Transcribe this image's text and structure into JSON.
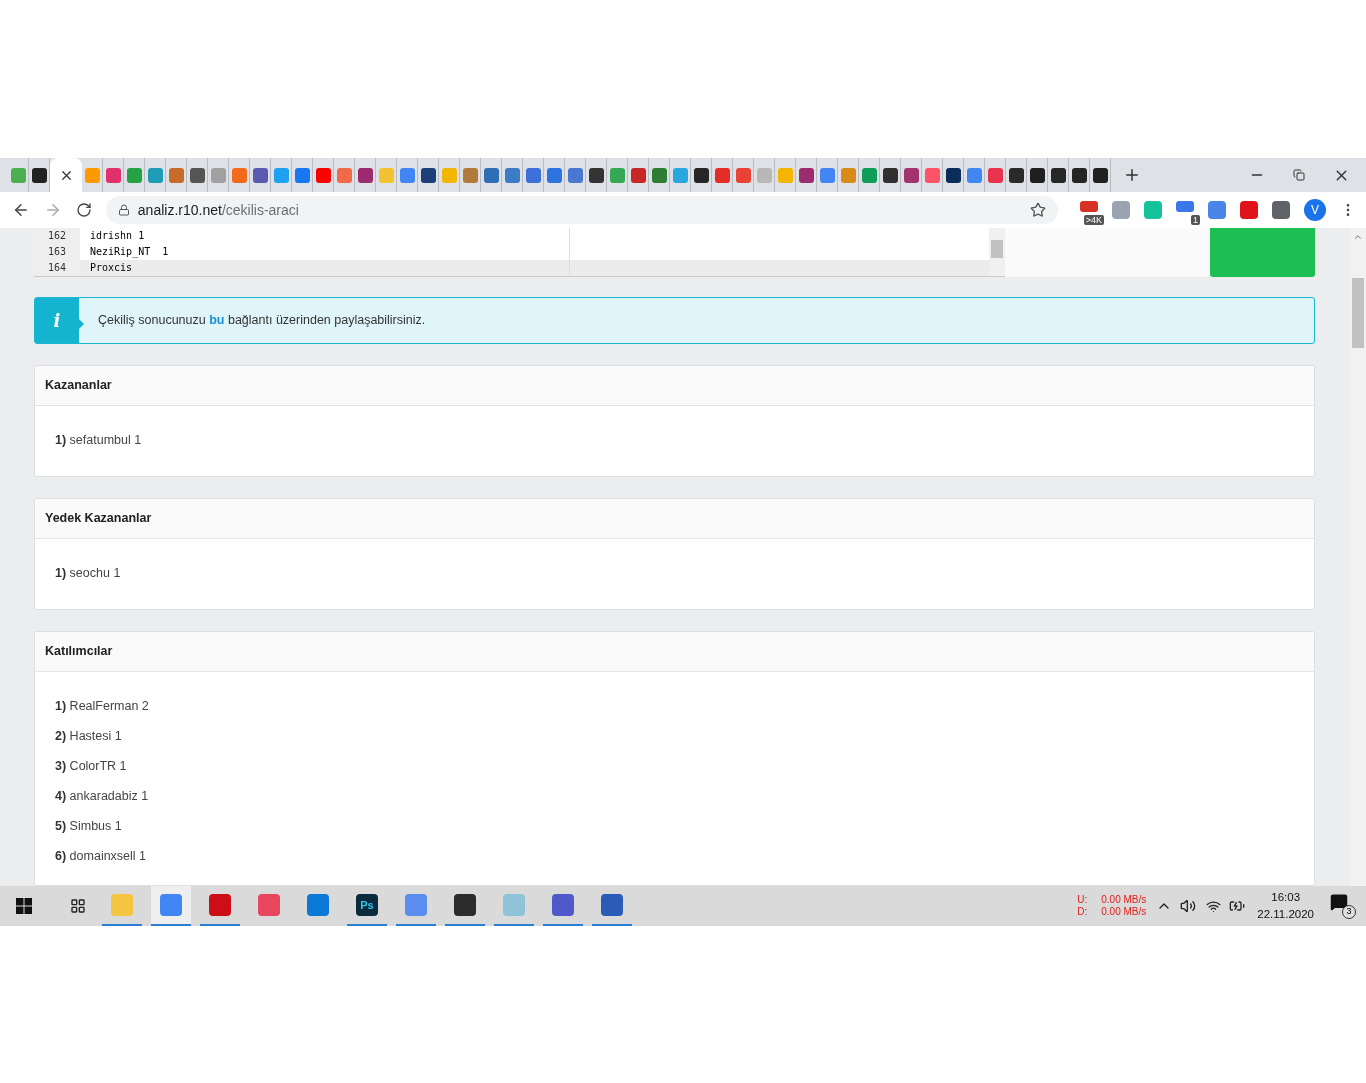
{
  "browser": {
    "tabs": [
      {
        "color": "#4caf50",
        "selected": false
      },
      {
        "color": "#222222",
        "selected": false
      },
      {
        "selected": true
      },
      {
        "color": "#ff9900",
        "selected": false
      },
      {
        "color": "#e1306c",
        "selected": false
      },
      {
        "color": "#25a244",
        "selected": false
      },
      {
        "color": "#1e9bb5",
        "selected": false
      },
      {
        "color": "#c76b2b",
        "selected": false
      },
      {
        "color": "#555555",
        "selected": false
      },
      {
        "color": "#a0a0a0",
        "selected": false
      },
      {
        "color": "#f26b1d",
        "selected": false
      },
      {
        "color": "#5a5ab0",
        "selected": false
      },
      {
        "color": "#1da1f2",
        "selected": false
      },
      {
        "color": "#1877f2",
        "selected": false
      },
      {
        "color": "#ff0000",
        "selected": false
      },
      {
        "color": "#f06a4a",
        "selected": false
      },
      {
        "color": "#9c2a6f",
        "selected": false
      },
      {
        "color": "#f2c230",
        "selected": false
      },
      {
        "color": "#4285f4",
        "selected": false
      },
      {
        "color": "#1c3f7a",
        "selected": false
      },
      {
        "color": "#f2b705",
        "selected": false
      },
      {
        "color": "#b07b3a",
        "selected": false
      },
      {
        "color": "#2f6db5",
        "selected": false
      },
      {
        "color": "#3b7cc4",
        "selected": false
      },
      {
        "color": "#3f6fd8",
        "selected": false
      },
      {
        "color": "#2d74e0",
        "selected": false
      },
      {
        "color": "#4a78d0",
        "selected": false
      },
      {
        "color": "#333333",
        "selected": false
      },
      {
        "color": "#34a853",
        "selected": false
      },
      {
        "color": "#c62828",
        "selected": false
      },
      {
        "color": "#2e7d32",
        "selected": false
      },
      {
        "color": "#29a8e0",
        "selected": false
      },
      {
        "color": "#262626",
        "selected": false
      },
      {
        "color": "#e52d27",
        "selected": false
      },
      {
        "color": "#ea4335",
        "selected": false
      },
      {
        "color": "#b8b8b8",
        "selected": false
      },
      {
        "color": "#f4b400",
        "selected": false
      },
      {
        "color": "#9b2c6d",
        "selected": false
      },
      {
        "color": "#4285f5",
        "selected": false
      },
      {
        "color": "#d98b1a",
        "selected": false
      },
      {
        "color": "#0f9d58",
        "selected": false
      },
      {
        "color": "#303030",
        "selected": false
      },
      {
        "color": "#a3336f",
        "selected": false
      },
      {
        "color": "#fe5268",
        "selected": false
      },
      {
        "color": "#0b2d5c",
        "selected": false
      },
      {
        "color": "#4286f3",
        "selected": false
      },
      {
        "color": "#e8334f",
        "selected": false
      },
      {
        "color": "#2a2a2a",
        "selected": false
      },
      {
        "color": "#1f1f1f",
        "selected": false
      },
      {
        "color": "#272727",
        "selected": false
      },
      {
        "color": "#242424",
        "selected": false
      },
      {
        "color": "#202020",
        "selected": false
      }
    ],
    "address": {
      "host": "analiz.r10.net",
      "path": "/cekilis-araci"
    },
    "extensions": [
      {
        "color": "#d93025",
        "badge": ">4K"
      },
      {
        "color": "#9aa4b0"
      },
      {
        "color": "#15c39a"
      },
      {
        "color": "#3b78e7",
        "badge": "1"
      },
      {
        "color": "#4a86e8"
      },
      {
        "color": "#e0131b"
      },
      {
        "color": "#5f6368"
      }
    ],
    "profile": "V"
  },
  "editor": {
    "lines": [
      {
        "number": "162",
        "text": "idrishn 1",
        "selected": false
      },
      {
        "number": "163",
        "text": "NeziRip_NT  1",
        "selected": false
      },
      {
        "number": "164",
        "text": "Proxcis",
        "selected": true
      }
    ]
  },
  "alert": {
    "icon": "i",
    "before": "Çekiliş sonucunuzu ",
    "link": "bu",
    "after": " bağlantı üzerinden paylaşabilirsiniz."
  },
  "cards": [
    {
      "title": "Kazananlar",
      "items": [
        {
          "index": "1)",
          "name": "sefatumbul 1"
        }
      ]
    },
    {
      "title": "Yedek Kazananlar",
      "items": [
        {
          "index": "1)",
          "name": "seochu 1"
        }
      ]
    },
    {
      "title": "Katılımcılar",
      "items": [
        {
          "index": "1)",
          "name": "RealFerman 2"
        },
        {
          "index": "2)",
          "name": "Hastesi 1"
        },
        {
          "index": "3)",
          "name": "ColorTR 1"
        },
        {
          "index": "4)",
          "name": "ankaradabiz 1"
        },
        {
          "index": "5)",
          "name": "Simbus 1"
        },
        {
          "index": "6)",
          "name": "domainxsell 1"
        }
      ]
    }
  ],
  "taskbar": {
    "apps": [
      {
        "color": "#f5c542",
        "running": true,
        "selected": false
      },
      {
        "color": "#4285f4",
        "running": true,
        "selected": true
      },
      {
        "color": "#cc0f16",
        "running": true,
        "selected": false
      },
      {
        "color": "#e8455f",
        "running": false,
        "selected": false
      },
      {
        "color": "#0a78d7",
        "running": false,
        "selected": false
      },
      {
        "color": "#0b2a3c",
        "running": true,
        "selected": false,
        "label": "Ps"
      },
      {
        "color": "#5b8def",
        "running": true,
        "selected": false
      },
      {
        "color": "#2b2b2b",
        "running": true,
        "selected": false
      },
      {
        "color": "#8ec3d9",
        "running": true,
        "selected": false
      },
      {
        "color": "#5059c9",
        "running": true,
        "selected": false
      },
      {
        "color": "#2a5bb8",
        "running": true,
        "selected": false
      }
    ],
    "upload_label": "U:",
    "upload": "0.00 MB/s",
    "download_label": "D:",
    "download": "0.00 MB/s",
    "time": "16:03",
    "date": "22.11.2020",
    "notifications": "3"
  }
}
